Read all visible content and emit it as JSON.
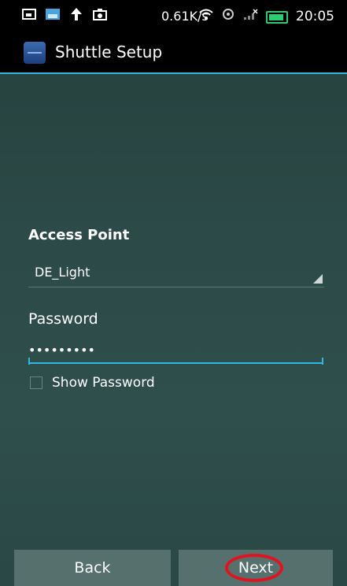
{
  "status_bar": {
    "net_speed": "0.61K/s",
    "time": "20:05",
    "icons": [
      "screenshot-icon",
      "gallery-icon",
      "upload-arrow-icon",
      "camera-icon",
      "wifi-icon",
      "sync-icon",
      "signal-icon",
      "battery-icon"
    ],
    "battery_color": "#2ecc71"
  },
  "action_bar": {
    "title": "Shuttle Setup",
    "accent_color": "#33b5e5"
  },
  "form": {
    "access_point_label": "Access Point",
    "access_point_value": "DE_Light",
    "password_label": "Password",
    "password_value": "•••••••••",
    "show_password_label": "Show Password",
    "show_password_checked": false
  },
  "buttons": {
    "back_label": "Back",
    "next_label": "Next"
  },
  "annotation": {
    "highlight_color": "#e0141e"
  }
}
